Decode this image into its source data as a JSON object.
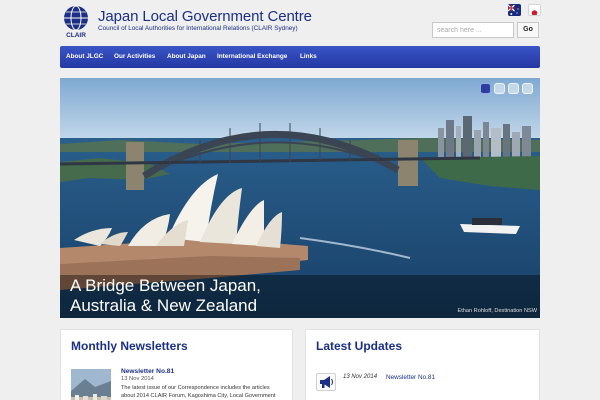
{
  "header": {
    "logo_text": "CLAIR",
    "title": "Japan Local Government Centre",
    "subtitle": "Council of Local Authorities for International Relations (CLAIR Sydney)",
    "search_placeholder": "search here ...",
    "search_button": "Go",
    "flags": [
      "australia-flag-icon",
      "japan-flag-icon"
    ]
  },
  "nav": {
    "items": [
      "About JLGC",
      "Our Activities",
      "About Japan",
      "International Exchange",
      "Links"
    ]
  },
  "hero": {
    "caption": "A Bridge Between Japan, Australia & New Zealand",
    "credit": "Ethan Rohloff, Destination NSW",
    "slides": 4,
    "active_slide": 1
  },
  "newsletters": {
    "title": "Monthly Newsletters",
    "item": {
      "title": "Newsletter No.81",
      "date": "13 Nov 2014",
      "summary": "The latest issue of our Correspondence includes the articles about 2014 CLAIR Forum, Kagoshima City, Local Government"
    }
  },
  "updates": {
    "title": "Latest Updates",
    "item": {
      "icon": "megaphone-icon",
      "date": "13 Nov 2014",
      "title": "Newsletter No.81"
    }
  },
  "colors": {
    "brand_blue": "#1b2f86",
    "nav_top": "#3a55c6",
    "nav_bottom": "#2438a3",
    "page_bg": "#efefef"
  }
}
